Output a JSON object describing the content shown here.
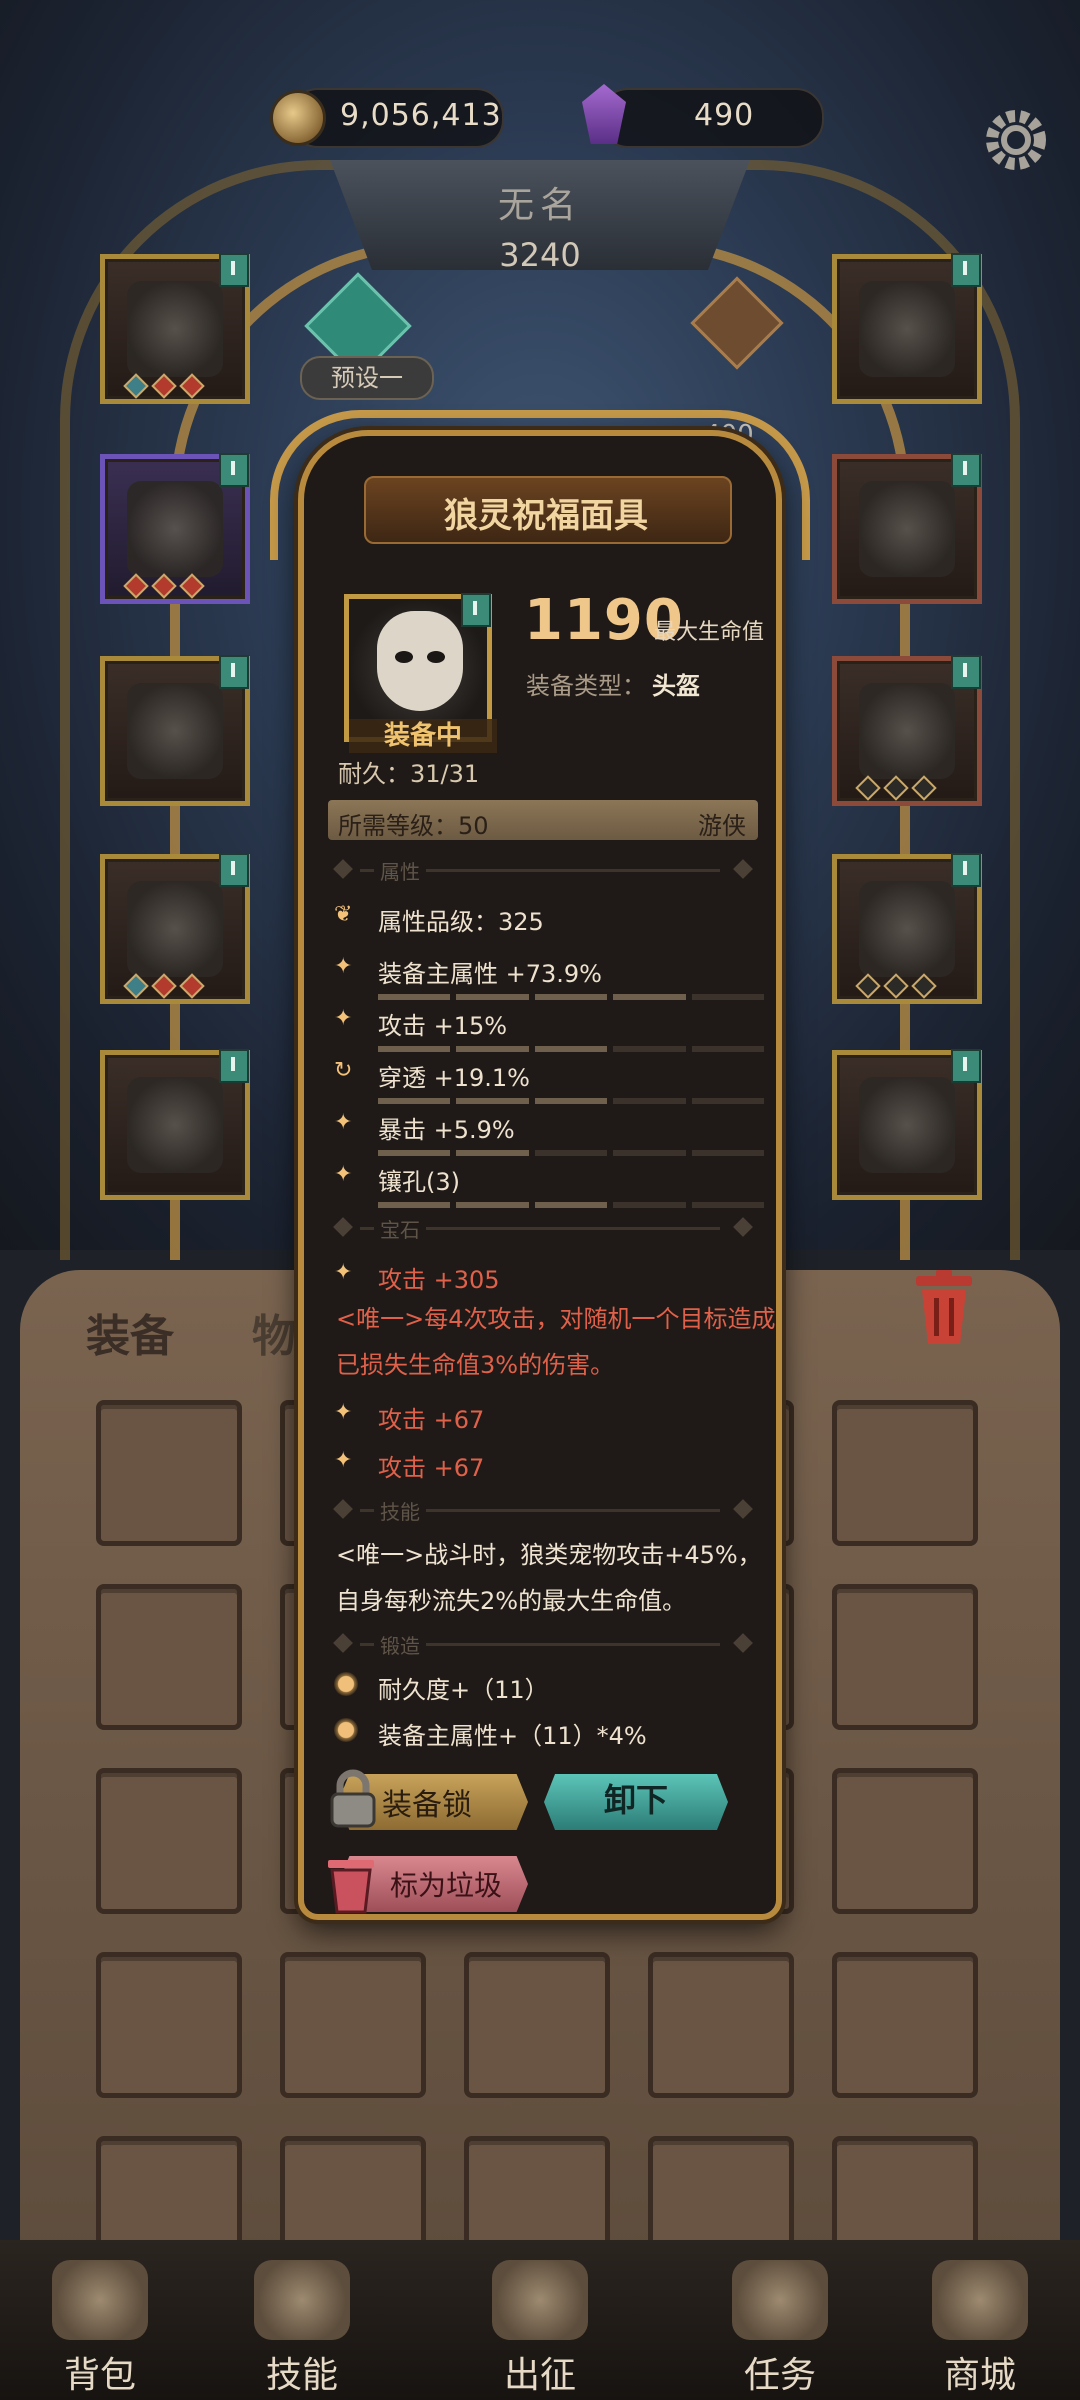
{
  "top_bar": {
    "gold": "9,056,413",
    "gems": "490"
  },
  "character": {
    "name": "无名",
    "power": "3240",
    "preset_label": "预设一",
    "side_value": "400"
  },
  "bag_tabs": {
    "equipment": "装备",
    "items": "物品"
  },
  "popup": {
    "title": "狼灵祝福面具",
    "equipped_label": "装备中",
    "main_value": "1190",
    "main_stat_label": "最大生命值",
    "type_label": "装备类型：",
    "type_value": "头盔",
    "durability": "耐久：31/31",
    "required_level": "所需等级：50",
    "required_class": "游侠",
    "sections": {
      "attributes": "属性",
      "gems": "宝石",
      "skills": "技能",
      "forge": "锻造"
    },
    "attribute_grade": "属性品级：325",
    "attributes": [
      {
        "text": "装备主属性 +73.9%",
        "icon": "sparkle-icon",
        "fill": 0.74
      },
      {
        "text": "攻击 +15%",
        "icon": "sparkle-icon",
        "fill": 0.6
      },
      {
        "text": "穿透 +19.1%",
        "icon": "refresh-icon",
        "fill": 0.5
      },
      {
        "text": "暴击 +5.9%",
        "icon": "sparkle-icon",
        "fill": 0.4
      },
      {
        "text": "镶孔(3)",
        "icon": "sparkle-icon",
        "fill": 0.6
      }
    ],
    "gems": [
      {
        "text": "攻击 +305"
      },
      {
        "text": "攻击 +67"
      },
      {
        "text": "攻击 +67"
      }
    ],
    "unique_effect": "<唯一>每4次攻击，对随机一个目标造成已损失生命值3%的伤害。",
    "skill_text": "<唯一>战斗时，狼类宠物攻击+45%，自身每秒流失2%的最大生命值。",
    "forge": [
      {
        "text": "耐久度+（11）"
      },
      {
        "text": "装备主属性+（11）*4%"
      }
    ],
    "buttons": {
      "lock": "装备锁",
      "unequip": "卸下",
      "junk": "标为垃圾"
    }
  },
  "nav": [
    {
      "label": "背包",
      "icon": "backpack-icon"
    },
    {
      "label": "技能",
      "icon": "skill-book-icon"
    },
    {
      "label": "出征",
      "icon": "battle-map-icon"
    },
    {
      "label": "任务",
      "icon": "quest-scroll-icon"
    },
    {
      "label": "商城",
      "icon": "shop-icon"
    }
  ],
  "colors": {
    "accent_gold": "#f0c78a",
    "unique_red": "#e0614a",
    "teal_button": "#3fa49a"
  }
}
